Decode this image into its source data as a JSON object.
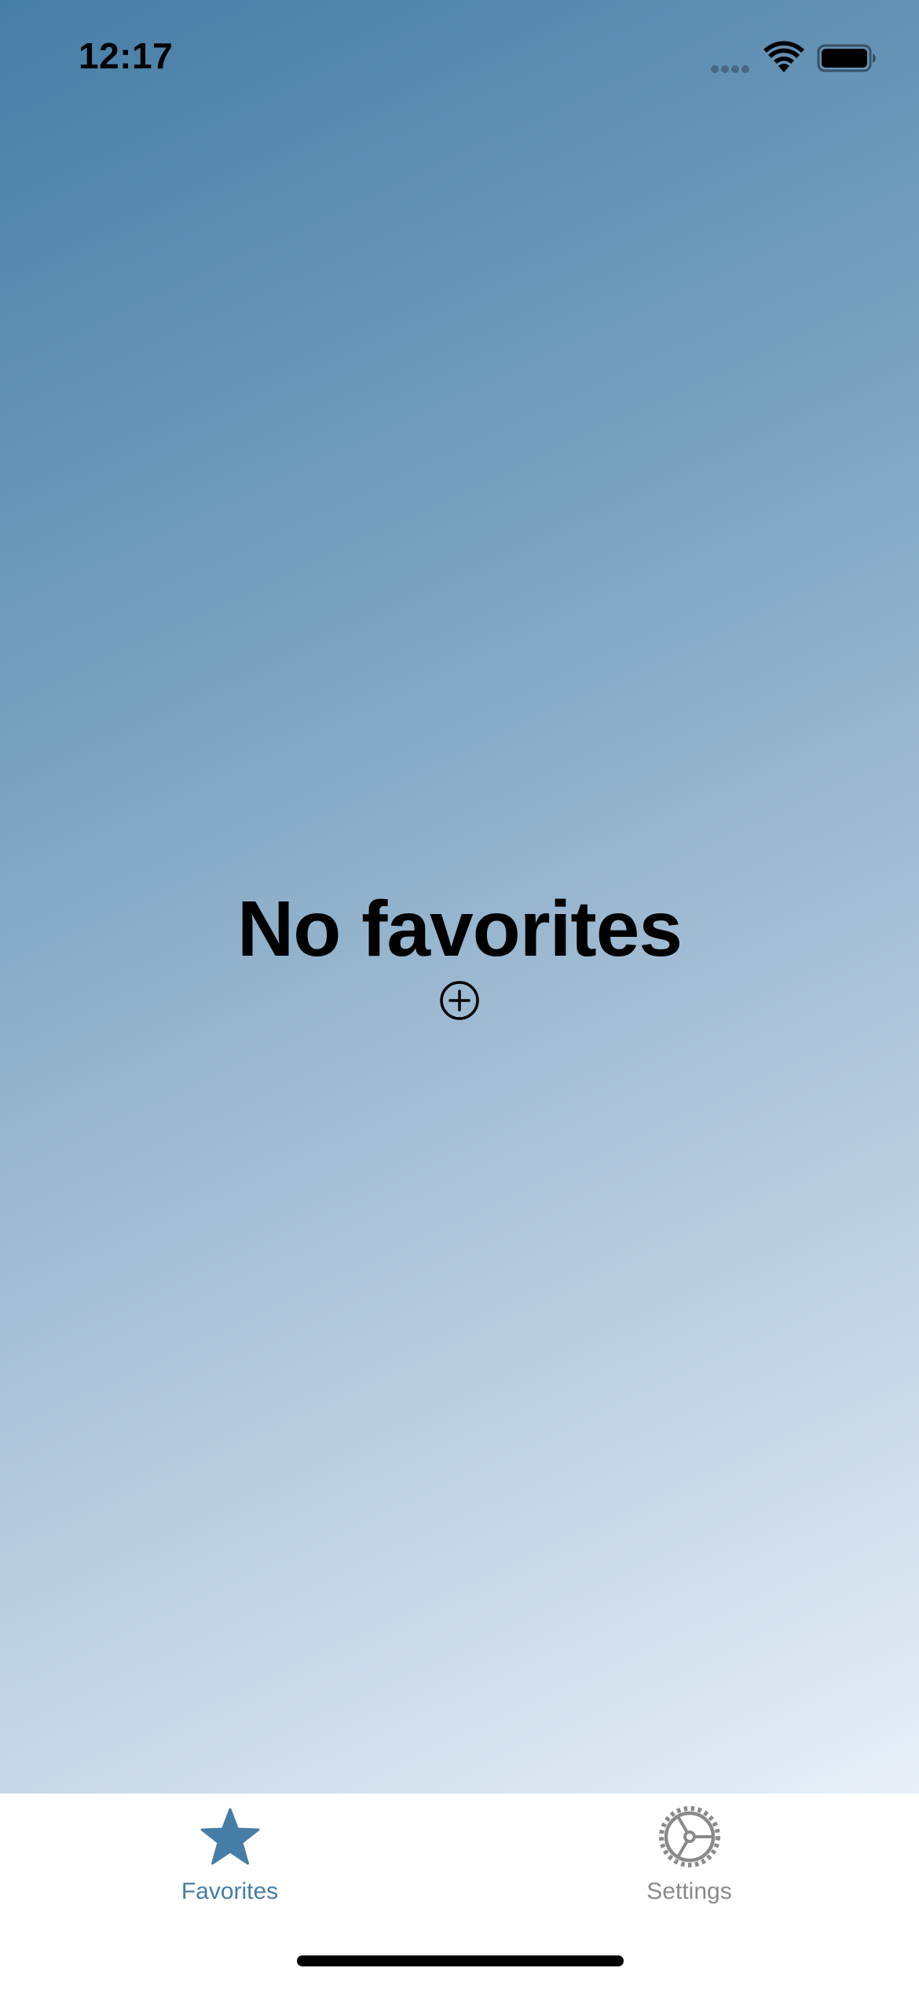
{
  "status_bar": {
    "time": "12:17",
    "icons": [
      "signal-icon",
      "wifi-icon",
      "battery-icon"
    ]
  },
  "empty_state": {
    "title": "No favorites",
    "add_icon": "plus-circle-icon"
  },
  "tab_bar": {
    "tabs": [
      {
        "label": "Favorites",
        "icon": "star-icon",
        "selected": true
      },
      {
        "label": "Settings",
        "icon": "gear-icon",
        "selected": false
      }
    ]
  },
  "colors": {
    "accent": "#467da6",
    "gradient_top": "#467da6",
    "gradient_bottom": "#e8eff8",
    "inactive_tab": "#8a8a8e"
  }
}
